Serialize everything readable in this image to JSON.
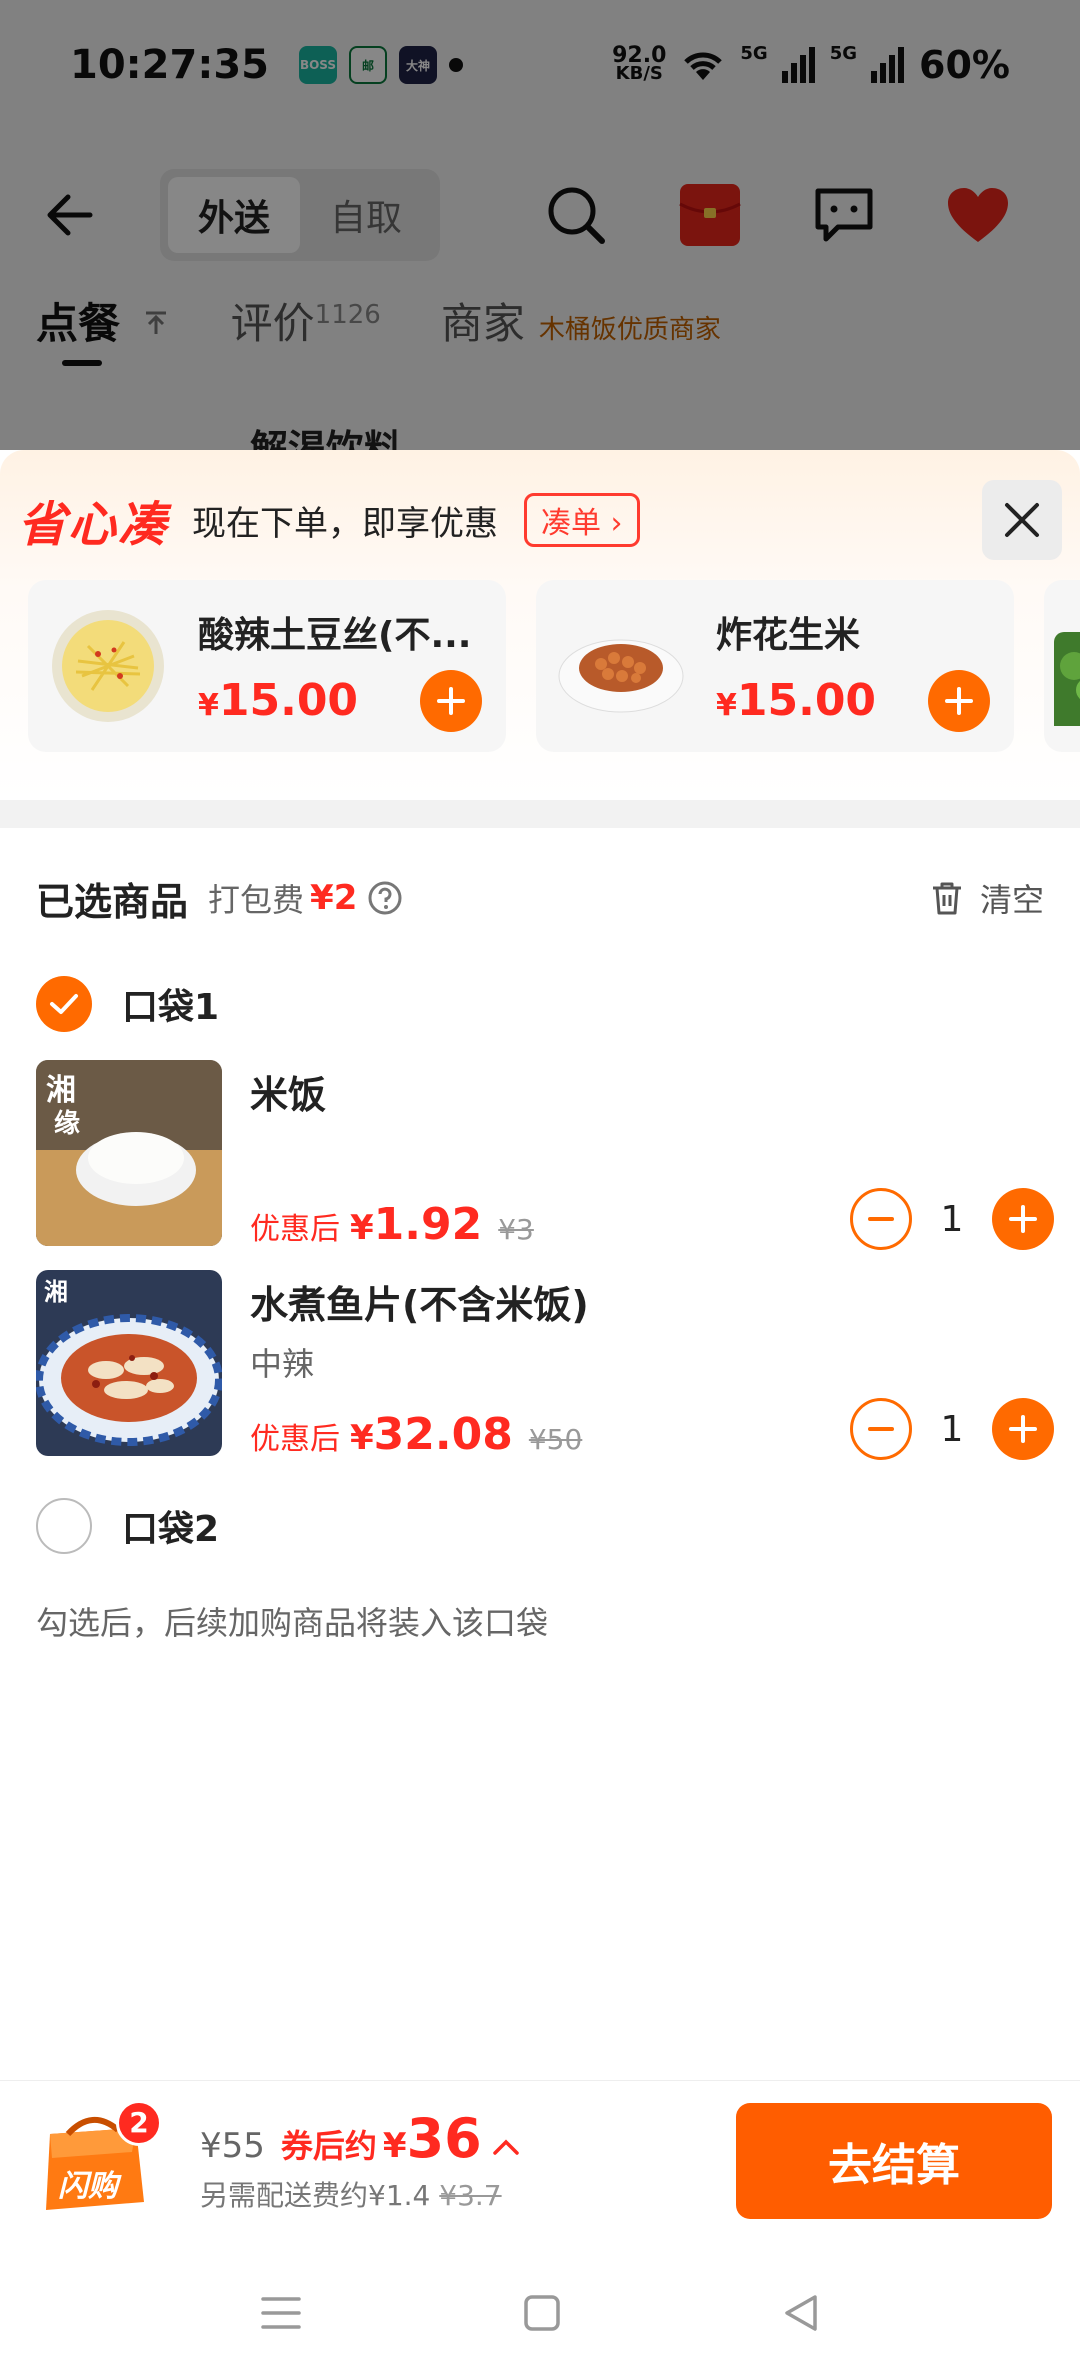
{
  "status": {
    "time": "10:27:35",
    "apps": [
      "BOSS\n直聘",
      "邮",
      "大神"
    ],
    "speed_value": "92.0",
    "speed_unit": "KB/S",
    "network1": "5G",
    "network2": "5G",
    "battery": "60%"
  },
  "nav": {
    "delivery": "外送",
    "pickup": "自取"
  },
  "tabs": {
    "order": "点餐",
    "reviews": "评价",
    "reviews_count": "1126",
    "merchant": "商家",
    "merchant_tag": "木桶饭优质商家"
  },
  "behind_section": "解渴饮料",
  "promo": {
    "logo": "省心凑",
    "text": "现在下单，即享优惠",
    "button": "凑单",
    "items": [
      {
        "name": "酸辣土豆丝(不...",
        "currency": "¥",
        "price": "15.00"
      },
      {
        "name": "炸花生米",
        "currency": "¥",
        "price": "15.00"
      }
    ]
  },
  "selected": {
    "title": "已选商品",
    "fee_label": "打包费",
    "fee_value": "¥2",
    "clear": "清空"
  },
  "bag1": {
    "label": "口袋1",
    "items": [
      {
        "name": "米饭",
        "spec": "",
        "price_label": "优惠后",
        "currency": "¥",
        "price": "1.92",
        "old_price": "¥3",
        "qty": "1"
      },
      {
        "name": "水煮鱼片(不含米饭)",
        "spec": "中辣",
        "price_label": "优惠后",
        "currency": "¥",
        "price": "32.08",
        "old_price": "¥50",
        "qty": "1"
      }
    ]
  },
  "bag2": {
    "label": "口袋2",
    "note": "勾选后，后续加购商品将装入该口袋"
  },
  "bottom": {
    "cart_badge": "2",
    "cart_label": "闪购",
    "original": "¥55",
    "after_label": "券后约",
    "currency": "¥",
    "total": "36",
    "delivery_note": "另需配送费约¥1.4",
    "delivery_old": "¥3.7",
    "checkout": "去结算"
  },
  "colors": {
    "accent": "#ff6a00",
    "price": "#ff2a20"
  }
}
